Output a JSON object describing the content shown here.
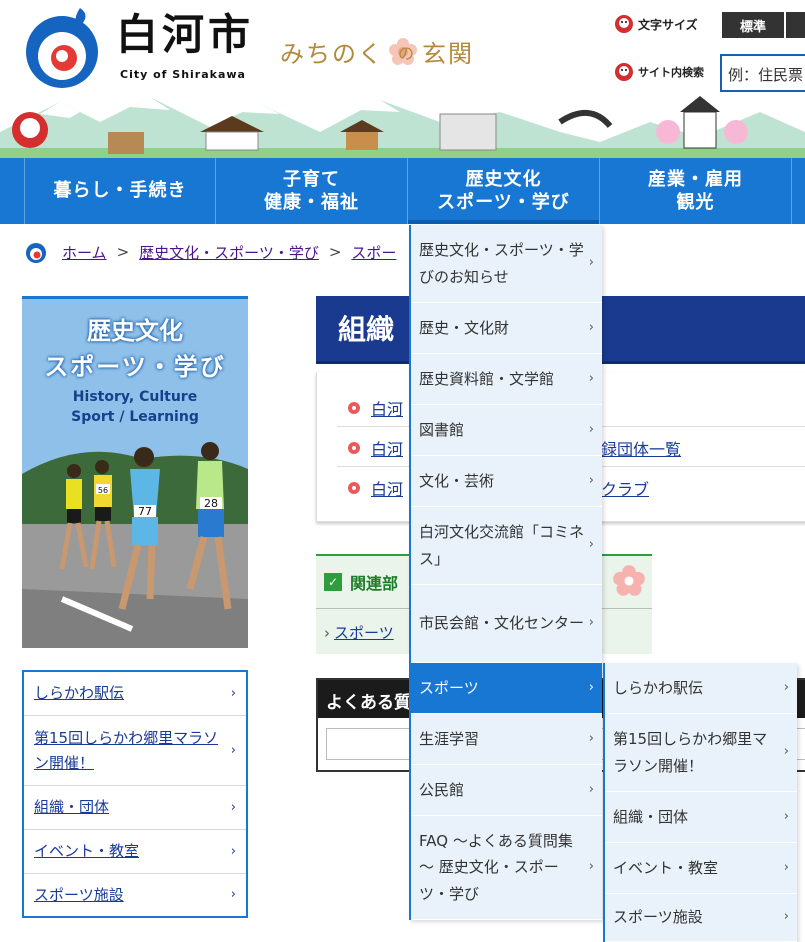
{
  "header": {
    "site_name": "白河市",
    "site_name_en": "City of Shirakawa",
    "tagline_before": "みちのく",
    "tagline_mid": "の",
    "tagline_after": "玄関",
    "font_size_label": "文字サイズ",
    "font_size_standard": "標準",
    "search_label": "サイト内検索",
    "search_placeholder": "例：住民票"
  },
  "nav": {
    "items": [
      {
        "line1": "暮らし・手続き",
        "line2": ""
      },
      {
        "line1": "子育て",
        "line2": "健康・福祉"
      },
      {
        "line1": "歴史文化",
        "line2": "スポーツ・学び"
      },
      {
        "line1": "産業・雇用",
        "line2": "観光"
      }
    ]
  },
  "breadcrumb": {
    "home": "ホーム",
    "sep": ">",
    "level1": "歴史文化・スポーツ・学び",
    "level2": "スポー"
  },
  "side_banner": {
    "title1": "歴史文化",
    "title2": "スポーツ・学び",
    "en1": "History, Culture",
    "en2": "Sport / Learning",
    "bib1": "77",
    "bib2": "28",
    "bib3": "56"
  },
  "side_list": [
    "しらかわ駅伝",
    "第15回しらかわ郷里マラソン開催！",
    "組織・団体",
    "イベント・教室",
    "スポーツ施設"
  ],
  "main": {
    "title": "組織",
    "links": [
      "白河",
      "白河",
      "白河"
    ],
    "link_tails": [
      "",
      "録団体一覧",
      "クラブ"
    ],
    "related_title": "関連部",
    "related_link": "スポーツ",
    "faq_title": "よくある質"
  },
  "dropdown": {
    "items": [
      "歴史文化・スポーツ・学びのお知らせ",
      "歴史・文化財",
      "歴史資料館・文学館",
      "図書館",
      "文化・芸術",
      "白河文化交流館「コミネス」",
      "市民会館・文化センター",
      "スポーツ",
      "生涯学習",
      "公民館",
      "FAQ ～よくある質問集～ 歴史文化・スポーツ・学び"
    ],
    "active_index": 7
  },
  "sub_dropdown": {
    "items": [
      "しらかわ駅伝",
      "第15回しらかわ郷里マラソン開催！",
      "組織・団体",
      "イベント・教室",
      "スポーツ施設"
    ]
  },
  "colors": {
    "nav_blue": "#1777d2",
    "title_navy": "#193a8e",
    "link": "#1a3a99",
    "related_green": "#2e9d3e"
  },
  "chevron": "›"
}
